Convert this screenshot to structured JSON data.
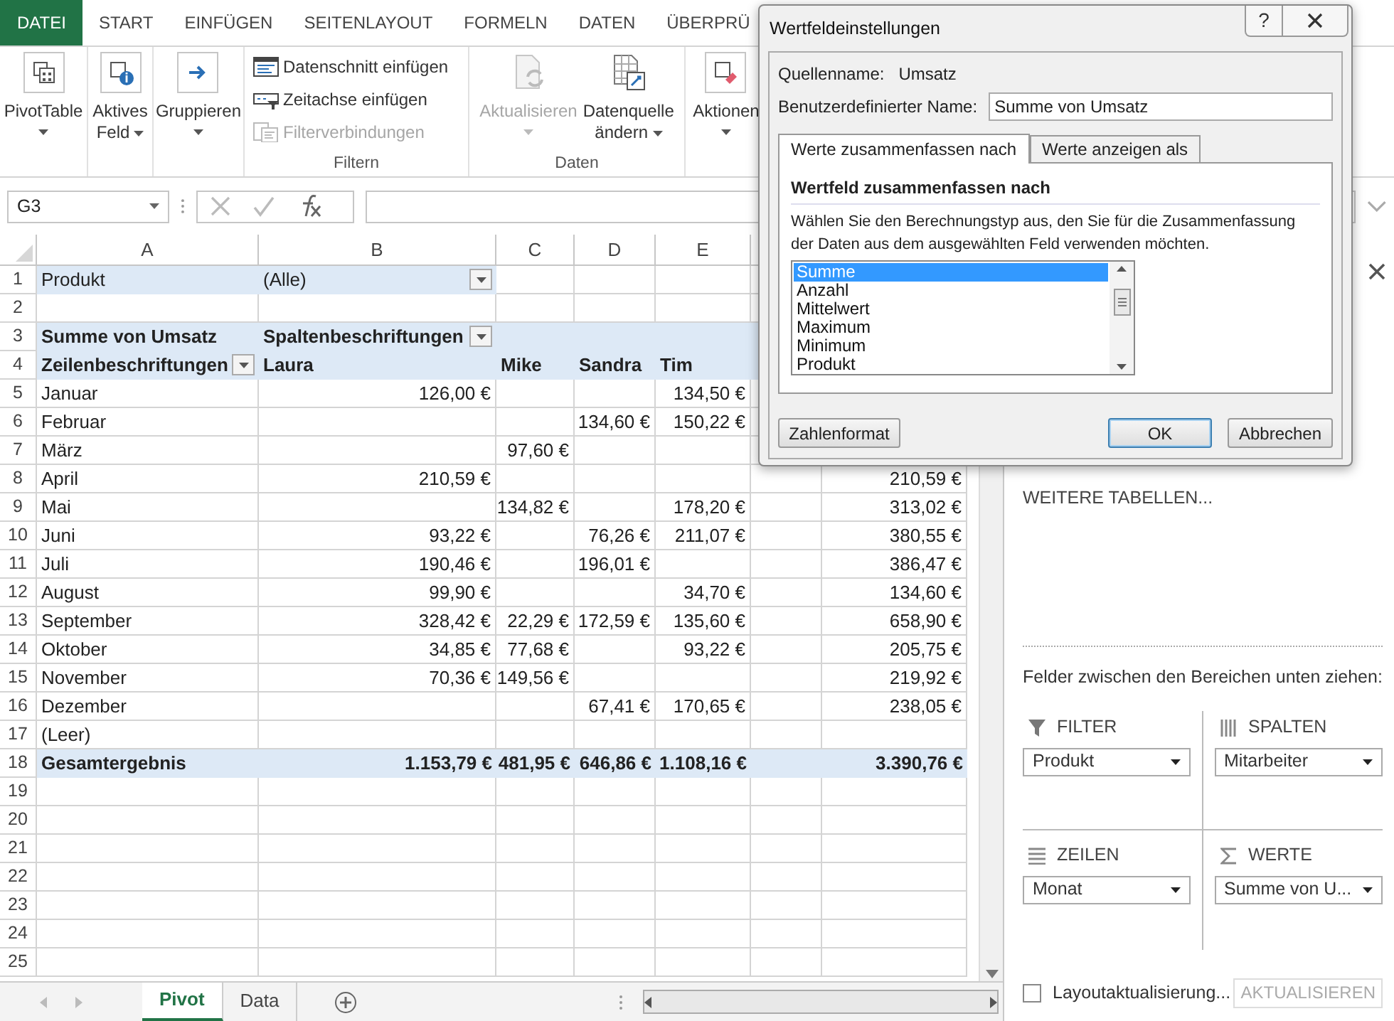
{
  "ribbon_tabs": [
    {
      "label": "DATEI",
      "kind": "file"
    },
    {
      "label": "START",
      "kind": "tab"
    },
    {
      "label": "EINFÜGEN",
      "kind": "tab"
    },
    {
      "label": "SEITENLAYOUT",
      "kind": "tab"
    },
    {
      "label": "FORMELN",
      "kind": "tab"
    },
    {
      "label": "DATEN",
      "kind": "tab"
    },
    {
      "label": "ÜBERPRÜ",
      "kind": "tab"
    }
  ],
  "ribbon_groups": [
    {
      "items": [
        {
          "kind": "large",
          "lines": [
            "PivotTable"
          ],
          "caret": true,
          "disabled": false
        }
      ]
    },
    {
      "items": [
        {
          "kind": "large",
          "lines": [
            "Aktives",
            "Feld"
          ],
          "caret": true,
          "disabled": false
        }
      ]
    },
    {
      "items": [
        {
          "kind": "large",
          "lines": [
            "Gruppieren"
          ],
          "caret": true,
          "disabled": false
        }
      ]
    },
    {
      "label": "Filtern",
      "items": [
        {
          "kind": "small",
          "lines": [
            "Datenschnitt einfügen"
          ],
          "caret": false,
          "disabled": false
        },
        {
          "kind": "small",
          "lines": [
            "Zeitachse einfügen"
          ],
          "caret": false,
          "disabled": false
        },
        {
          "kind": "small",
          "lines": [
            "Filterverbindungen"
          ],
          "caret": false,
          "disabled": true
        }
      ]
    },
    {
      "label": "Daten",
      "items": [
        {
          "kind": "large",
          "lines": [
            "Aktualisieren"
          ],
          "caret": true,
          "disabled": true
        },
        {
          "kind": "large",
          "lines": [
            "Datenquelle",
            "ändern"
          ],
          "caret": true,
          "disabled": false
        }
      ]
    },
    {
      "items": [
        {
          "kind": "large",
          "lines": [
            "Aktionen"
          ],
          "caret": true,
          "disabled": false
        }
      ]
    }
  ],
  "formula_bar": {
    "name_box": "G3"
  },
  "columns": [
    "A",
    "B",
    "C",
    "D",
    "E"
  ],
  "rows": [
    {
      "number": "1",
      "kind": "filter",
      "dropdowns": {
        "B": true
      },
      "cells": {
        "A": "Produkt",
        "B": "(Alle)"
      }
    },
    {
      "number": "2",
      "kind": "blank"
    },
    {
      "number": "3",
      "kind": "header",
      "dropdowns": {
        "B": true
      },
      "cells": {
        "A": "Summe von Umsatz",
        "B": "Spaltenbeschriftungen"
      }
    },
    {
      "number": "4",
      "kind": "header",
      "dropdowns": {
        "A": true
      },
      "cells": {
        "A": "Zeilenbeschriftungen",
        "B": "Laura",
        "C": "Mike",
        "D": "Sandra",
        "E": "Tim"
      }
    },
    {
      "number": "5",
      "kind": "data",
      "cells": {
        "A": "Januar",
        "B": "126,00 €",
        "E": "134,50 €"
      }
    },
    {
      "number": "6",
      "kind": "data",
      "cells": {
        "A": "Februar",
        "D": "134,60 €",
        "E": "150,22 €"
      }
    },
    {
      "number": "7",
      "kind": "data",
      "cells": {
        "A": "März",
        "C": "97,60 €"
      }
    },
    {
      "number": "8",
      "kind": "data",
      "cells": {
        "A": "April",
        "B": "210,59 €",
        "G": "210,59 €"
      }
    },
    {
      "number": "9",
      "kind": "data",
      "cells": {
        "A": "Mai",
        "C": "134,82 €",
        "E": "178,20 €",
        "G": "313,02 €"
      }
    },
    {
      "number": "10",
      "kind": "data",
      "cells": {
        "A": "Juni",
        "B": "93,22 €",
        "D": "76,26 €",
        "E": "211,07 €",
        "G": "380,55 €"
      }
    },
    {
      "number": "11",
      "kind": "data",
      "cells": {
        "A": "Juli",
        "B": "190,46 €",
        "D": "196,01 €",
        "G": "386,47 €"
      }
    },
    {
      "number": "12",
      "kind": "data",
      "cells": {
        "A": "August",
        "B": "99,90 €",
        "E": "34,70 €",
        "G": "134,60 €"
      }
    },
    {
      "number": "13",
      "kind": "data",
      "cells": {
        "A": "September",
        "B": "328,42 €",
        "C": "22,29 €",
        "D": "172,59 €",
        "E": "135,60 €",
        "G": "658,90 €"
      }
    },
    {
      "number": "14",
      "kind": "data",
      "cells": {
        "A": "Oktober",
        "B": "34,85 €",
        "C": "77,68 €",
        "E": "93,22 €",
        "G": "205,75 €"
      }
    },
    {
      "number": "15",
      "kind": "data",
      "cells": {
        "A": "November",
        "B": "70,36 €",
        "C": "149,56 €",
        "G": "219,92 €"
      }
    },
    {
      "number": "16",
      "kind": "data",
      "cells": {
        "A": "Dezember",
        "D": "67,41 €",
        "E": "170,65 €",
        "G": "238,05 €"
      }
    },
    {
      "number": "17",
      "kind": "data",
      "cells": {
        "A": "(Leer)"
      }
    },
    {
      "number": "18",
      "kind": "total",
      "cells": {
        "A": "Gesamtergebnis",
        "B": "1.153,79 €",
        "C": "481,95 €",
        "D": "646,86 €",
        "E": "1.108,16 €",
        "G": "3.390,76 €"
      }
    },
    {
      "number": "19",
      "kind": "blank"
    },
    {
      "number": "20",
      "kind": "blank"
    },
    {
      "number": "21",
      "kind": "blank"
    },
    {
      "number": "22",
      "kind": "blank"
    },
    {
      "number": "23",
      "kind": "blank"
    },
    {
      "number": "24",
      "kind": "blank"
    },
    {
      "number": "25",
      "kind": "blank"
    }
  ],
  "sheet_tabs": [
    {
      "label": "Pivot",
      "selected": true
    },
    {
      "label": "Data",
      "selected": false
    }
  ],
  "field_pane": {
    "more_tables": "WEITERE TABELLEN...",
    "instruction": "Felder zwischen den Bereichen unten ziehen:",
    "areas": [
      {
        "title": "FILTER",
        "field": "Produkt"
      },
      {
        "title": "SPALTEN",
        "field": "Mitarbeiter"
      },
      {
        "title": "ZEILEN",
        "field": "Monat"
      },
      {
        "title": "WERTE",
        "field": "Summe von U..."
      }
    ],
    "defer_update": {
      "label": "Layoutaktualisierung...",
      "checked": false
    },
    "update_button": {
      "label": "AKTUALISIEREN",
      "disabled": true
    }
  },
  "dialog": {
    "title": "Wertfeldeinstellungen",
    "help": "?",
    "source_label": "Quellenname:",
    "source_value": "Umsatz",
    "name_label": "Benutzerdefinierter Name:",
    "name_value": "Summe von Umsatz",
    "tabs": [
      {
        "label": "Werte zusammenfassen nach",
        "selected": true
      },
      {
        "label": "Werte anzeigen als",
        "selected": false
      }
    ],
    "heading": "Wertfeld zusammenfassen nach",
    "description": "Wählen Sie den Berechnungstyp aus, den Sie für die Zusammenfassung der Daten aus dem ausgewählten Feld verwenden möchten.",
    "functions": [
      {
        "label": "Summe",
        "selected": true
      },
      {
        "label": "Anzahl",
        "selected": false
      },
      {
        "label": "Mittelwert",
        "selected": false
      },
      {
        "label": "Maximum",
        "selected": false
      },
      {
        "label": "Minimum",
        "selected": false
      },
      {
        "label": "Produkt",
        "selected": false
      }
    ],
    "buttons": [
      {
        "label": "Zahlenformat",
        "kind": "left"
      },
      {
        "label": "OK",
        "kind": "default"
      },
      {
        "label": "Abbrechen",
        "kind": "normal"
      }
    ]
  }
}
